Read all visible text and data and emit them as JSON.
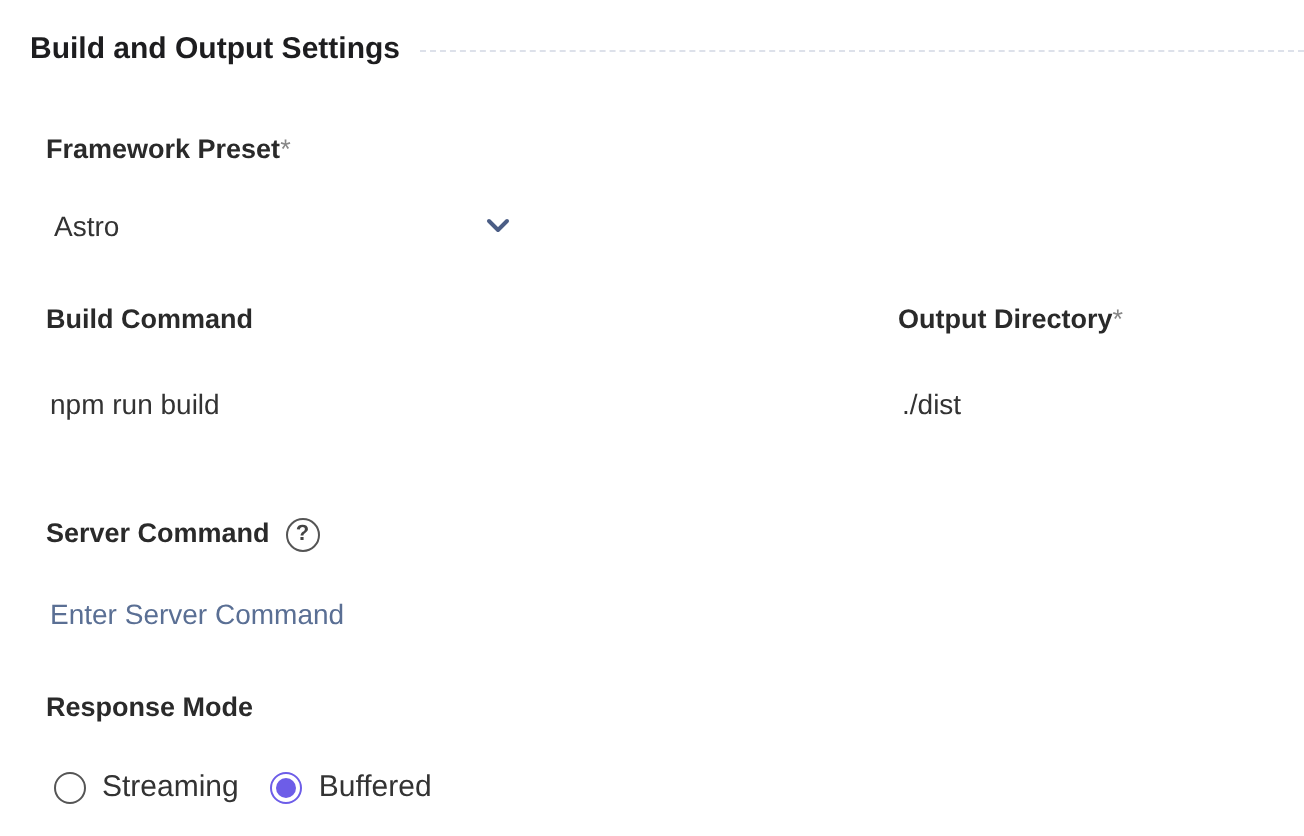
{
  "section": {
    "title": "Build and Output Settings"
  },
  "framework_preset": {
    "label": "Framework Preset",
    "required_mark": "*",
    "value": "Astro"
  },
  "build_command": {
    "label": "Build Command",
    "value": "npm run build"
  },
  "output_directory": {
    "label": "Output Directory",
    "required_mark": "*",
    "value": "./dist"
  },
  "server_command": {
    "label": "Server Command",
    "help": "?",
    "placeholder": "Enter Server Command"
  },
  "response_mode": {
    "label": "Response Mode",
    "options": [
      {
        "label": "Streaming",
        "selected": false
      },
      {
        "label": "Buffered",
        "selected": true
      }
    ]
  }
}
